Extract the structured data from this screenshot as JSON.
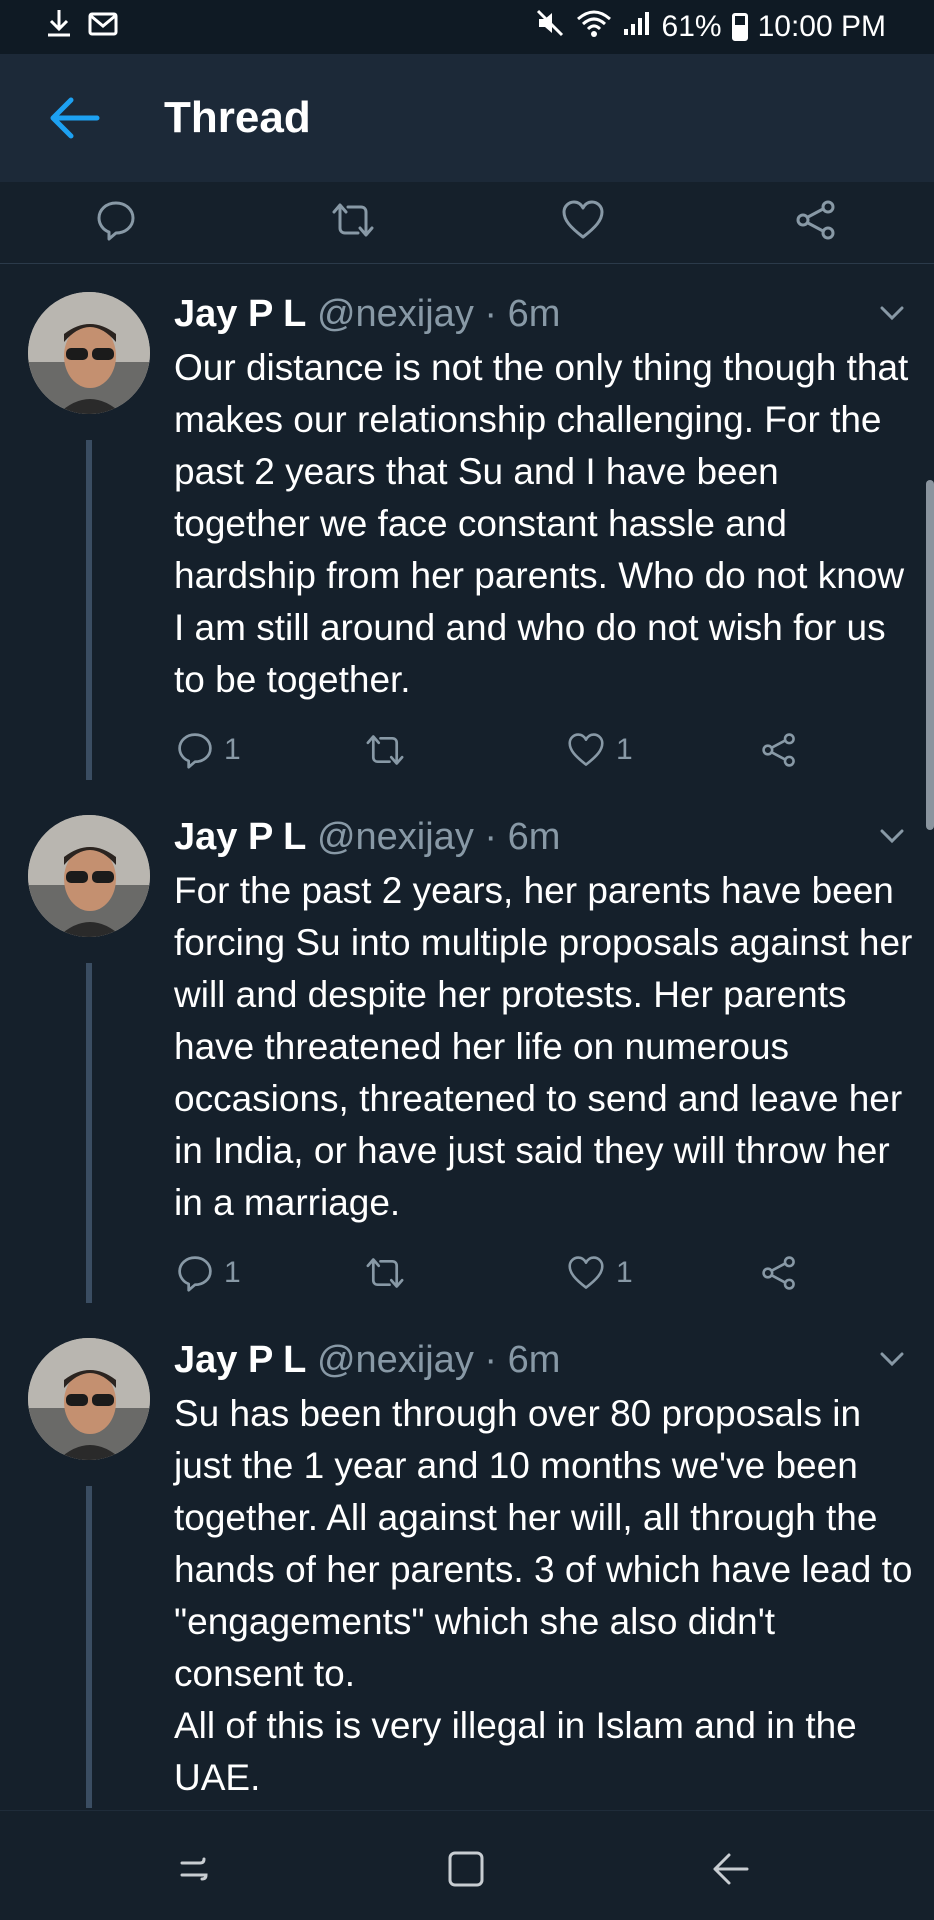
{
  "status_bar": {
    "download_icon": "download-icon",
    "mail_icon": "gmail-icon",
    "battery": "61%",
    "time": "10:00 PM"
  },
  "header": {
    "title": "Thread"
  },
  "tweets": [
    {
      "name": "Jay P L",
      "handle": "@nexijay",
      "dot": "·",
      "time": "6m",
      "text": "Our distance is not the only thing though that makes our relationship challenging. For the past 2 years that Su and I have been together we face constant hassle and hardship from her parents. Who do not know I am still around and who do not wish for us to be together.",
      "replies": "1",
      "likes": "1"
    },
    {
      "name": "Jay P L",
      "handle": "@nexijay",
      "dot": "·",
      "time": "6m",
      "text": "For the past 2 years, her parents have been forcing Su into multiple proposals against her will and despite her protests. Her parents have threatened her life on numerous occasions, threatened to send and leave her in India, or have just said they will throw her in a marriage.",
      "replies": "1",
      "likes": "1"
    },
    {
      "name": "Jay P L",
      "handle": "@nexijay",
      "dot": "·",
      "time": "6m",
      "text_line1": "Su has been through over 80 proposals in just the 1 year and 10 months we've been together. All against her will, all through the hands of her parents. 3 of which have lead to \"engagements\" which she also didn't consent to.",
      "text_line2": "All of this is very illegal in Islam and in the UAE."
    }
  ]
}
